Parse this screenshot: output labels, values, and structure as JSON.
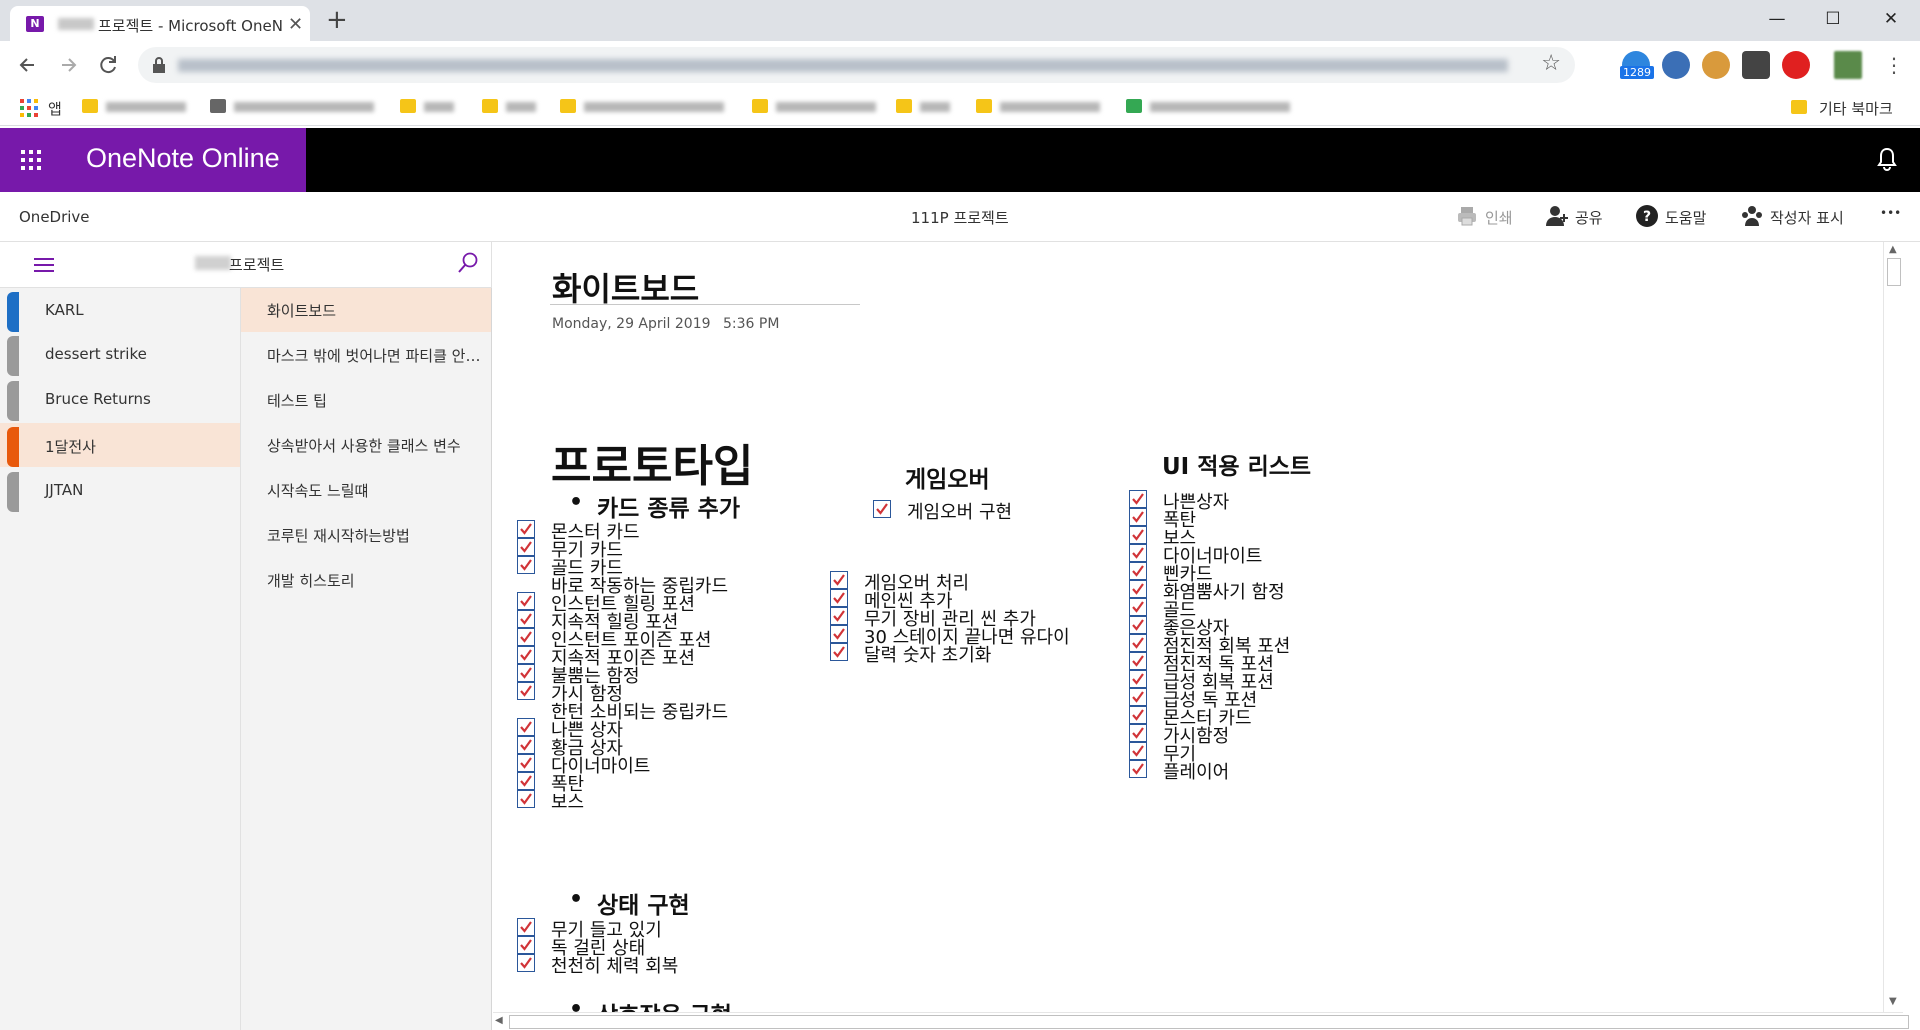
{
  "browser": {
    "tab_title": "프로젝트 - Microsoft OneNote Online",
    "tab_close": "✕",
    "new_tab": "+",
    "window": {
      "minimize": "—",
      "maximize": "☐",
      "close": "✕"
    },
    "extension_badge": "1289",
    "bookmarks": {
      "apps_label": "앱",
      "other_label": "기타 북마크"
    }
  },
  "app": {
    "brand": "OneNote Online",
    "breadcrumb": "OneDrive",
    "notebook_title": "111P 프로젝트",
    "commands": {
      "print": "인쇄",
      "share": "공유",
      "help": "도움말",
      "show_authors": "작성자 표시",
      "more": "•••"
    }
  },
  "notebook": {
    "name": "프로젝트",
    "sections": [
      {
        "label": "KARL",
        "color": "#1e6fc5"
      },
      {
        "label": "dessert strike",
        "color": "#9a9a9a"
      },
      {
        "label": "Bruce Returns",
        "color": "#9a9a9a"
      },
      {
        "label": "1달전사",
        "color": "#e8590c"
      },
      {
        "label": "JJTAN",
        "color": "#9a9a9a"
      }
    ],
    "pages": [
      {
        "label": "화이트보드"
      },
      {
        "label": "마스크 밖에 벗어나면 파티클 안그리는 방법"
      },
      {
        "label": "테스트 팁"
      },
      {
        "label": "상속받아서 사용한 클래스 변수"
      },
      {
        "label": "시작속도 느릴떄"
      },
      {
        "label": "코루틴 재시작하는방법"
      },
      {
        "label": "개발 히스토리"
      }
    ]
  },
  "page": {
    "title": "화이트보드",
    "date": "Monday, 29 April 2019",
    "time": "5:36 PM",
    "prototype": {
      "heading": "프로토타입",
      "card_heading": "카드 종류 추가",
      "card_items": [
        {
          "text": "몬스터 카드",
          "checked": true
        },
        {
          "text": "무기 카드",
          "checked": true
        },
        {
          "text": "골드 카드",
          "checked": true
        },
        {
          "text": "바로 작동하는 중립카드",
          "checked": false
        },
        {
          "text": "인스턴트 힐링 포션",
          "checked": true
        },
        {
          "text": "지속적 힐링 포션",
          "checked": true
        },
        {
          "text": "인스턴트 포이즌 포션",
          "checked": true
        },
        {
          "text": "지속적 포이즌 포션",
          "checked": true
        },
        {
          "text": "불뿜는 함정",
          "checked": true
        },
        {
          "text": "가시 함정",
          "checked": true
        },
        {
          "text": "한턴 소비되는 중립카드",
          "checked": false
        },
        {
          "text": "나쁜 상자",
          "checked": true
        },
        {
          "text": "황금 상자",
          "checked": true
        },
        {
          "text": "다이너마이트",
          "checked": true
        },
        {
          "text": "폭탄",
          "checked": true
        },
        {
          "text": "보스",
          "checked": true
        }
      ],
      "state_heading": "상태 구현",
      "state_items": [
        {
          "text": "무기 들고 있기",
          "checked": true
        },
        {
          "text": "독 걸린 상태",
          "checked": true
        },
        {
          "text": "천천히 체력 회복",
          "checked": true
        }
      ],
      "cut_heading": "상호작용 구현"
    },
    "gameover": {
      "heading": "게임오버",
      "items": [
        {
          "text": "게임오버 구현",
          "checked": true
        }
      ],
      "items2": [
        {
          "text": "게임오버 처리",
          "checked": true
        },
        {
          "text": "메인씬 추가",
          "checked": true
        },
        {
          "text": "무기 장비 관리 씬 추가",
          "checked": true
        },
        {
          "text": "30 스테이지 끝나면 유다이",
          "checked": true
        },
        {
          "text": "달력 숫자 초기화",
          "checked": true
        }
      ]
    },
    "ui_list": {
      "heading": "UI 적용 리스트",
      "items": [
        {
          "text": "나쁜상자",
          "checked": true
        },
        {
          "text": "폭탄",
          "checked": true
        },
        {
          "text": "보스",
          "checked": true
        },
        {
          "text": "다이너마이트",
          "checked": true
        },
        {
          "text": "삔카드",
          "checked": true
        },
        {
          "text": "화염뿜사기 함정",
          "checked": true
        },
        {
          "text": "골드",
          "checked": true
        },
        {
          "text": "좋은상자",
          "checked": true
        },
        {
          "text": "점진적 회복 포션",
          "checked": true
        },
        {
          "text": "점진적 독 포션",
          "checked": true
        },
        {
          "text": "급성 회복 포션",
          "checked": true
        },
        {
          "text": "급성 독 포션",
          "checked": true
        },
        {
          "text": "몬스터 카드",
          "checked": true
        },
        {
          "text": "가시함정",
          "checked": true
        },
        {
          "text": "무기",
          "checked": true
        },
        {
          "text": "플레이어",
          "checked": true
        }
      ]
    }
  },
  "colors": {
    "brand": "#7719aa",
    "selection": "#f9e4d6",
    "checkbox_border": "#2b579a",
    "checkmark": "#d13438"
  }
}
